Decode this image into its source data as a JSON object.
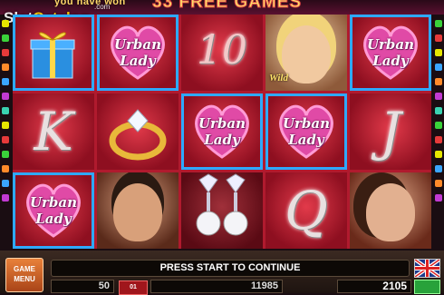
{
  "banner": {
    "won_text": "you have won",
    "free_games_text": "33 FREE GAMES"
  },
  "watermark": {
    "slot": "Slot",
    "catalog": "Catalog",
    "com": ".com"
  },
  "reels": {
    "row1": [
      "gift-box",
      "urban-lady",
      "10",
      "wild-woman",
      "urban-lady"
    ],
    "row2": [
      "K",
      "diamond-ring",
      "urban-lady",
      "urban-lady",
      "J"
    ],
    "row3": [
      "urban-lady",
      "man",
      "pearl-earrings",
      "Q",
      "woman-with-jewels"
    ]
  },
  "symbols": {
    "urban_lady_line1": "Urban",
    "urban_lady_line2": "Lady",
    "ten": "10",
    "k": "K",
    "j": "J",
    "q": "Q",
    "wild": "Wild"
  },
  "controls": {
    "menu_line1": "GAME",
    "menu_line2": "MENU",
    "message": "PRESS START TO CONTINUE",
    "lines_value": "50",
    "red_button_label": "01",
    "bet_value": "11985",
    "credit_value": "2105",
    "language_flag": "uk-flag-icon"
  },
  "colors": {
    "reel_bg": "#b01a2e",
    "frame_blue": "#2ea9ff",
    "menu_orange": "#e9813a"
  }
}
